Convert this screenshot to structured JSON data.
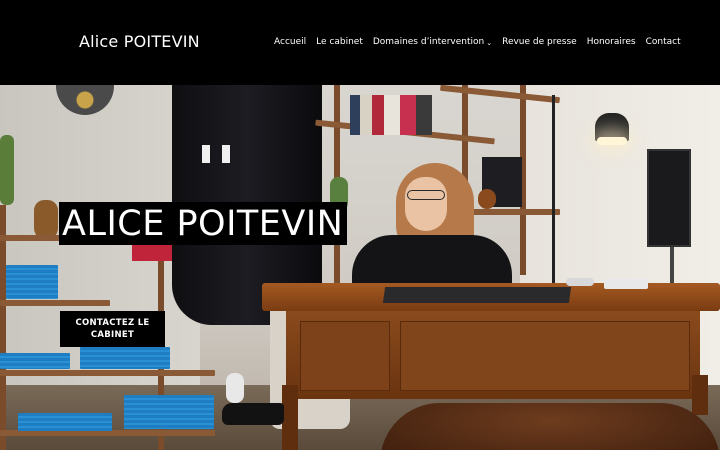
{
  "header": {
    "brand": "Alice POITEVIN",
    "nav": [
      {
        "label": "Accueil"
      },
      {
        "label": "Le cabinet"
      },
      {
        "label": "Domaines d’intervention",
        "has_dropdown": true,
        "icon": "chevron-down-icon"
      },
      {
        "label": "Revue de presse"
      },
      {
        "label": "Honoraires"
      },
      {
        "label": "Contact"
      }
    ]
  },
  "hero": {
    "title": "ALICE POITEVIN",
    "cta_label": "CONTACTEZ LE CABINET"
  },
  "colors": {
    "header_bg": "#000000",
    "text": "#ffffff",
    "overlay_bg": "#000000"
  }
}
